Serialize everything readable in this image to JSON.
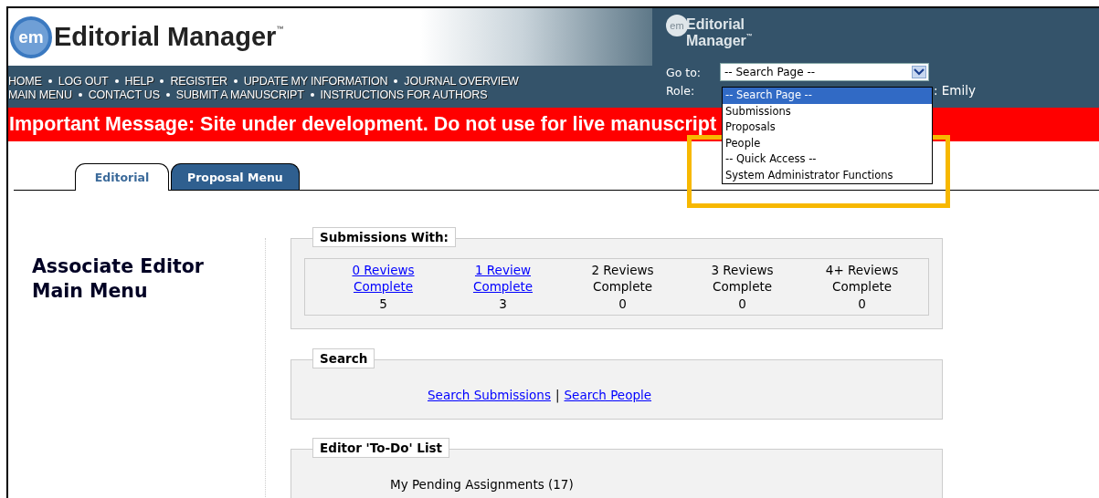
{
  "header": {
    "logo": {
      "mark": "em",
      "name": "Editorial Manager",
      "tm": "™"
    },
    "right_logo": {
      "mark": "em",
      "line1": "Editorial",
      "line2": "Manager",
      "tm": "™"
    },
    "nav_rows": [
      [
        "HOME",
        "LOG OUT",
        "HELP",
        "REGISTER",
        "UPDATE MY INFORMATION",
        "JOURNAL OVERVIEW"
      ],
      [
        "MAIN MENU",
        "CONTACT US",
        "SUBMIT A MANUSCRIPT",
        "INSTRUCTIONS FOR AUTHORS"
      ]
    ],
    "goto": {
      "label": "Go to:",
      "value": "-- Search Page --",
      "options": [
        {
          "label": "-- Search Page --",
          "selected": true
        },
        {
          "label": "Submissions",
          "selected": false
        },
        {
          "label": "Proposals",
          "selected": false
        },
        {
          "label": "People",
          "selected": false
        },
        {
          "label": "-- Quick Access --",
          "selected": false
        },
        {
          "label": "System Administrator Functions",
          "selected": false
        }
      ]
    },
    "role": {
      "label": "Role:",
      "user": ": Emily"
    }
  },
  "message": "Important Message: Site under development. Do not use for live manuscript",
  "tabs": [
    {
      "label": "Editorial",
      "selected": true
    },
    {
      "label": "Proposal Menu",
      "selected": false
    }
  ],
  "page_title": "Associate Editor Main Menu",
  "submissions": {
    "title": "Submissions With:",
    "columns": [
      {
        "label": "0 Reviews Complete",
        "link": true,
        "count": "5"
      },
      {
        "label": "1 Review Complete",
        "link": true,
        "count": "3"
      },
      {
        "label": "2 Reviews Complete",
        "link": false,
        "count": "0"
      },
      {
        "label": "3 Reviews Complete",
        "link": false,
        "count": "0"
      },
      {
        "label": "4+ Reviews Complete",
        "link": false,
        "count": "0"
      }
    ]
  },
  "search": {
    "title": "Search",
    "links": [
      "Search Submissions",
      "Search People"
    ],
    "separator": "|"
  },
  "todo": {
    "title": "Editor 'To-Do' List",
    "items": [
      "My Pending Assignments (17)"
    ]
  }
}
